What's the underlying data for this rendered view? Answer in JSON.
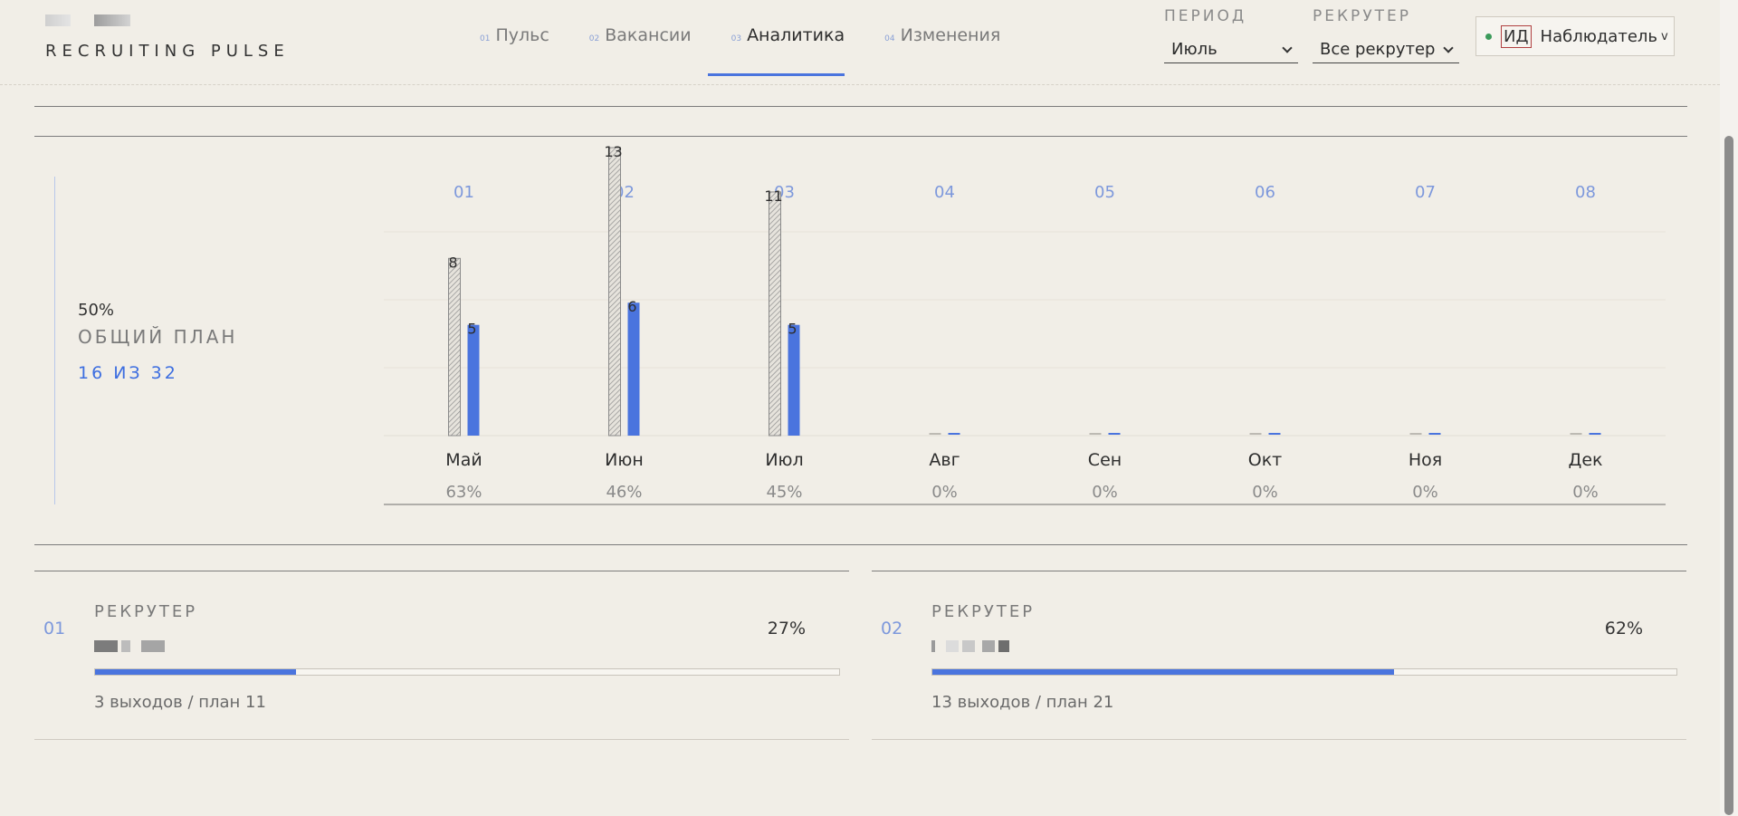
{
  "header": {
    "brand": "RECRUITING PULSE",
    "nav": [
      {
        "num": "01",
        "label": "Пульс"
      },
      {
        "num": "02",
        "label": "Вакансии"
      },
      {
        "num": "03",
        "label": "Аналитика"
      },
      {
        "num": "04",
        "label": "Изменения"
      }
    ],
    "active_nav": 2,
    "period": {
      "label": "ПЕРИОД",
      "value": "Июль"
    },
    "recruiter": {
      "label": "РЕКРУТЕР",
      "value": "Все рекрутер"
    },
    "user": {
      "initials": "ИД",
      "role": "Наблюдатель",
      "caret": "v"
    }
  },
  "plan": {
    "percent": "50%",
    "title": "ОБЩИЙ ПЛАН",
    "count": "16 ИЗ 32"
  },
  "chart_data": {
    "type": "bar",
    "categories": [
      "Май",
      "Июн",
      "Июл",
      "Авг",
      "Сен",
      "Окт",
      "Ноя",
      "Дек"
    ],
    "indices": [
      "01",
      "02",
      "03",
      "04",
      "05",
      "06",
      "07",
      "08"
    ],
    "series": [
      {
        "values": [
          8,
          13,
          11,
          0,
          0,
          0,
          0,
          0
        ],
        "color": "#9a9a9a",
        "pattern": "hatched"
      },
      {
        "values": [
          5,
          6,
          5,
          0,
          0,
          0,
          0,
          0
        ],
        "color": "#4a74de"
      }
    ],
    "bottom_labels": [
      "63%",
      "46%",
      "45%",
      "0%",
      "0%",
      "0%",
      "0%",
      "0%"
    ],
    "ylim": [
      0,
      13
    ],
    "grid": true
  },
  "recruiters": [
    {
      "index": "01",
      "label": "РЕКРУТЕР",
      "percent": "27%",
      "progress": 0.27,
      "note": "3 выходов / план 11"
    },
    {
      "index": "02",
      "label": "РЕКРУТЕР",
      "percent": "62%",
      "progress": 0.62,
      "note": "13 выходов / план 21"
    }
  ]
}
